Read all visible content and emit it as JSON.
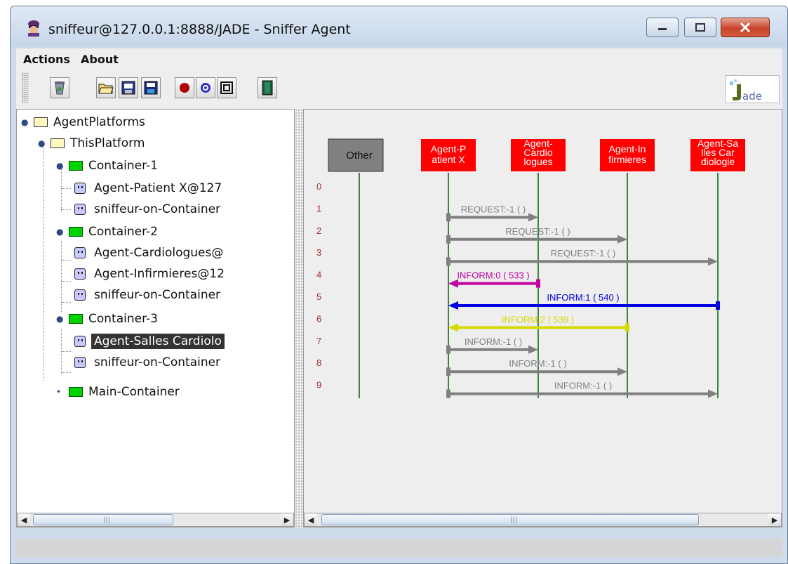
{
  "window": {
    "title": "sniffeur@127.0.0.1:8888/JADE - Sniffer Agent"
  },
  "menu": {
    "items": [
      "Actions",
      "About"
    ]
  },
  "toolbar": {
    "buttons": [
      "clear-canvas-icon",
      "open-file-icon",
      "display-log-icon",
      "save-icon",
      "do-sniff-icon",
      "do-not-sniff-icon",
      "show-only-icon",
      "exit-icon"
    ],
    "logo_text": "Jade"
  },
  "tree": {
    "root": "AgentPlatforms",
    "platform": "ThisPlatform",
    "containers": [
      {
        "name": "Container-1",
        "agents": [
          "Agent-Patient X@127",
          "sniffeur-on-Container"
        ]
      },
      {
        "name": "Container-2",
        "agents": [
          "Agent-Cardiologues@",
          "Agent-Infirmieres@12",
          "sniffeur-on-Container"
        ]
      },
      {
        "name": "Container-3",
        "agents": [
          "Agent-Salles Cardiolo",
          "sniffeur-on-Container"
        ]
      },
      {
        "name": "Main-Container",
        "agents": []
      }
    ],
    "selected": "Agent-Salles Cardiolo"
  },
  "sniffer": {
    "other_label": "Other",
    "agents": [
      {
        "lines": [
          "Agent-P",
          "atient X"
        ]
      },
      {
        "lines": [
          "Agent-",
          "Cardio",
          "logues"
        ]
      },
      {
        "lines": [
          "Agent-In",
          "firmieres"
        ]
      },
      {
        "lines": [
          "Agent-Sa",
          "lles Car",
          "diologie"
        ]
      }
    ],
    "row_numbers": [
      "0",
      "1",
      "2",
      "3",
      "4",
      "5",
      "6",
      "7",
      "8",
      "9"
    ],
    "messages": [
      {
        "row": 1,
        "label": "REQUEST:-1 (       )",
        "from": 0,
        "to": 1,
        "color": "#808080"
      },
      {
        "row": 2,
        "label": "REQUEST:-1 (       )",
        "from": 0,
        "to": 2,
        "color": "#808080"
      },
      {
        "row": 3,
        "label": "REQUEST:-1 (       )",
        "from": 0,
        "to": 3,
        "color": "#808080"
      },
      {
        "row": 4,
        "label": "INFORM:0 (  533  )",
        "from": 1,
        "to": 0,
        "color": "#c000a0"
      },
      {
        "row": 5,
        "label": "INFORM:1 (  540   )",
        "from": 3,
        "to": 0,
        "color": "#0000e0"
      },
      {
        "row": 6,
        "label": "INFORM:2 (  539   )",
        "from": 2,
        "to": 0,
        "color": "#d8d800"
      },
      {
        "row": 7,
        "label": "INFORM:-1 (       )",
        "from": 0,
        "to": 1,
        "color": "#808080"
      },
      {
        "row": 8,
        "label": "INFORM:-1 (       )",
        "from": 0,
        "to": 2,
        "color": "#808080"
      },
      {
        "row": 9,
        "label": "INFORM:-1 (       )",
        "from": 0,
        "to": 3,
        "color": "#808080"
      }
    ]
  },
  "colors": {
    "agent_box": "#ff0000",
    "other_box": "#808080",
    "lifeline": "#006400",
    "row_number": "#a03030",
    "selection": "#333333"
  }
}
